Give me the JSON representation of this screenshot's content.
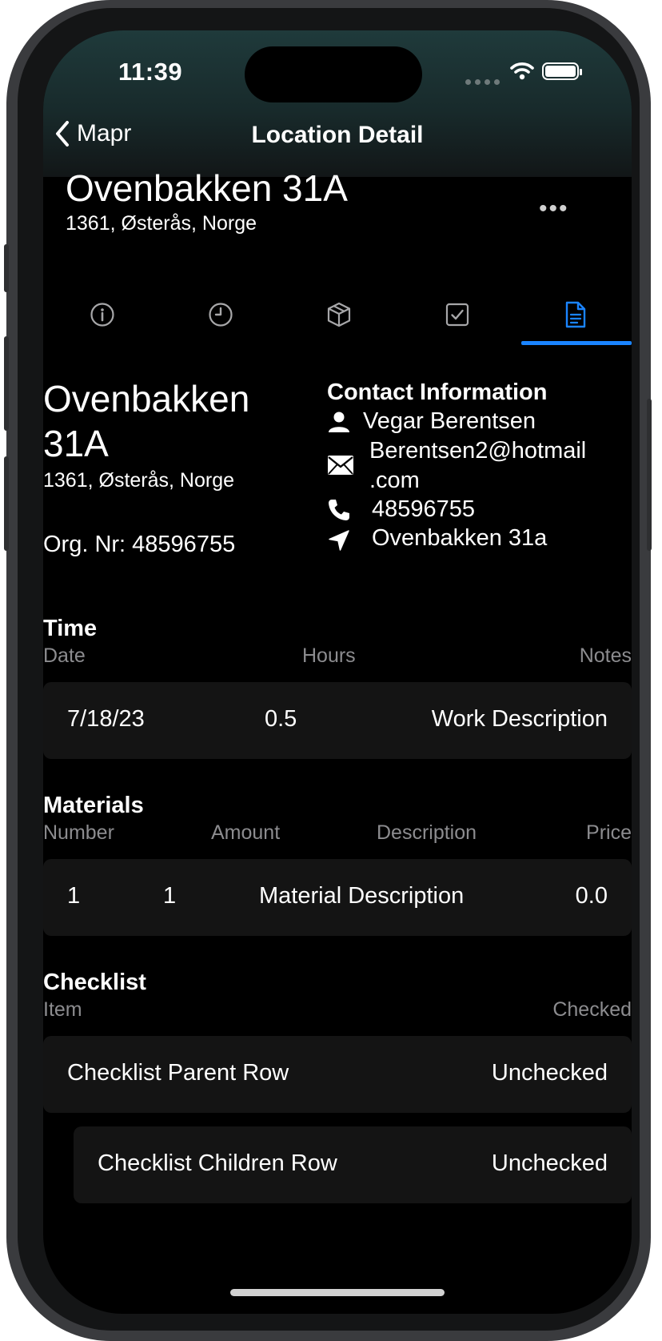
{
  "status": {
    "time": "11:39"
  },
  "nav": {
    "back_label": "Mapr",
    "title": "Location Detail"
  },
  "header": {
    "title": "Ovenbakken 31A",
    "subtitle": "1361, Østerås, Norge",
    "more": "•••"
  },
  "tabs": [
    {
      "icon": "info-icon",
      "active": false
    },
    {
      "icon": "clock-icon",
      "active": false
    },
    {
      "icon": "box-icon",
      "active": false
    },
    {
      "icon": "checkbox-icon",
      "active": false
    },
    {
      "icon": "document-icon",
      "active": true
    }
  ],
  "accent_color": "#1a84ff",
  "location": {
    "name_line1": "Ovenbakken",
    "name_line2": "31A",
    "address": "1361, Østerås, Norge",
    "org": "Org. Nr: 48596755"
  },
  "contact": {
    "title": "Contact Information",
    "name": "Vegar Berentsen",
    "email_line1": "Berentsen2@hotmail",
    "email_line2": ".com",
    "phone": "48596755",
    "address": "Ovenbakken 31a"
  },
  "time": {
    "title": "Time",
    "headers": {
      "date": "Date",
      "hours": "Hours",
      "notes": "Notes"
    },
    "row": {
      "date": "7/18/23",
      "hours": "0.5",
      "notes": "Work Description"
    }
  },
  "materials": {
    "title": "Materials",
    "headers": {
      "number": "Number",
      "amount": "Amount",
      "description": "Description",
      "price": "Price"
    },
    "row": {
      "number": "1",
      "amount": "1",
      "description": "Material Description",
      "price": "0.0"
    }
  },
  "checklist": {
    "title": "Checklist",
    "headers": {
      "item": "Item",
      "checked": "Checked"
    },
    "rows": [
      {
        "item": "Checklist Parent Row",
        "checked": "Unchecked"
      },
      {
        "item": "Checklist Children Row",
        "checked": "Unchecked"
      }
    ]
  }
}
